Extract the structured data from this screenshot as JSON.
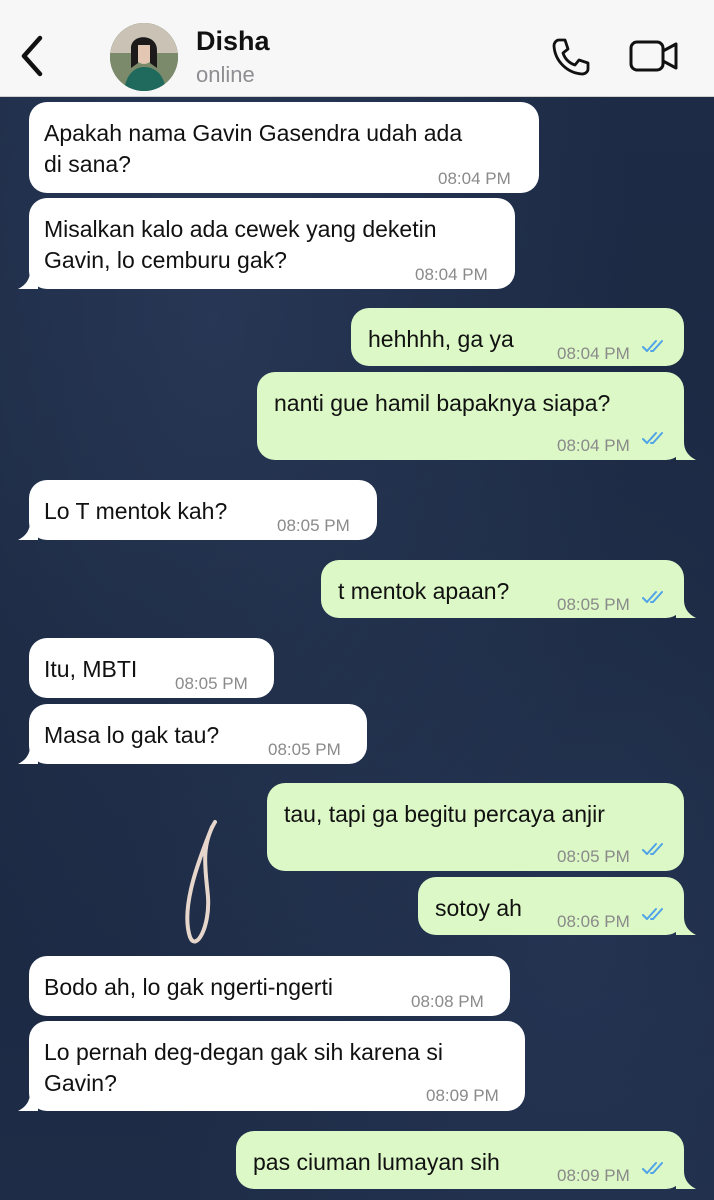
{
  "header": {
    "contact_name": "Disha",
    "status": "online",
    "back_icon": "chevron-left-icon",
    "call_icon": "phone-icon",
    "video_icon": "video-camera-icon"
  },
  "colors": {
    "incoming_bubble": "#ffffff",
    "outgoing_bubble": "#dcf8c6",
    "read_ticks": "#4fa3e8",
    "header_bg": "#f7f7f7"
  },
  "messages": [
    {
      "direction": "in",
      "text": "Apakah nama Gavin Gasendra udah ada\ndi sana?",
      "time": "08:04 PM"
    },
    {
      "direction": "in",
      "text": "Misalkan kalo ada cewek yang deketin\nGavin, lo cemburu gak?",
      "time": "08:04 PM"
    },
    {
      "direction": "out",
      "text": "hehhhh, ga ya",
      "time": "08:04 PM",
      "status": "read"
    },
    {
      "direction": "out",
      "text": "nanti gue hamil bapaknya siapa?",
      "time": "08:04 PM",
      "status": "read"
    },
    {
      "direction": "in",
      "text": "Lo T mentok kah?",
      "time": "08:05 PM"
    },
    {
      "direction": "out",
      "text": "t mentok apaan?",
      "time": "08:05 PM",
      "status": "read"
    },
    {
      "direction": "in",
      "text": "Itu, MBTI",
      "time": "08:05 PM"
    },
    {
      "direction": "in",
      "text": "Masa lo gak tau?",
      "time": "08:05 PM"
    },
    {
      "direction": "out",
      "text": "tau, tapi ga begitu percaya anjir",
      "time": "08:05 PM",
      "status": "read"
    },
    {
      "direction": "out",
      "text": "sotoy ah",
      "time": "08:06 PM",
      "status": "read"
    },
    {
      "direction": "in",
      "text": "Bodo ah, lo gak ngerti-ngerti",
      "time": "08:08 PM"
    },
    {
      "direction": "in",
      "text": "Lo pernah deg-degan gak sih karena si\nGavin?",
      "time": "08:09 PM"
    },
    {
      "direction": "out",
      "text": "pas ciuman lumayan sih",
      "time": "08:09 PM",
      "status": "read"
    }
  ]
}
